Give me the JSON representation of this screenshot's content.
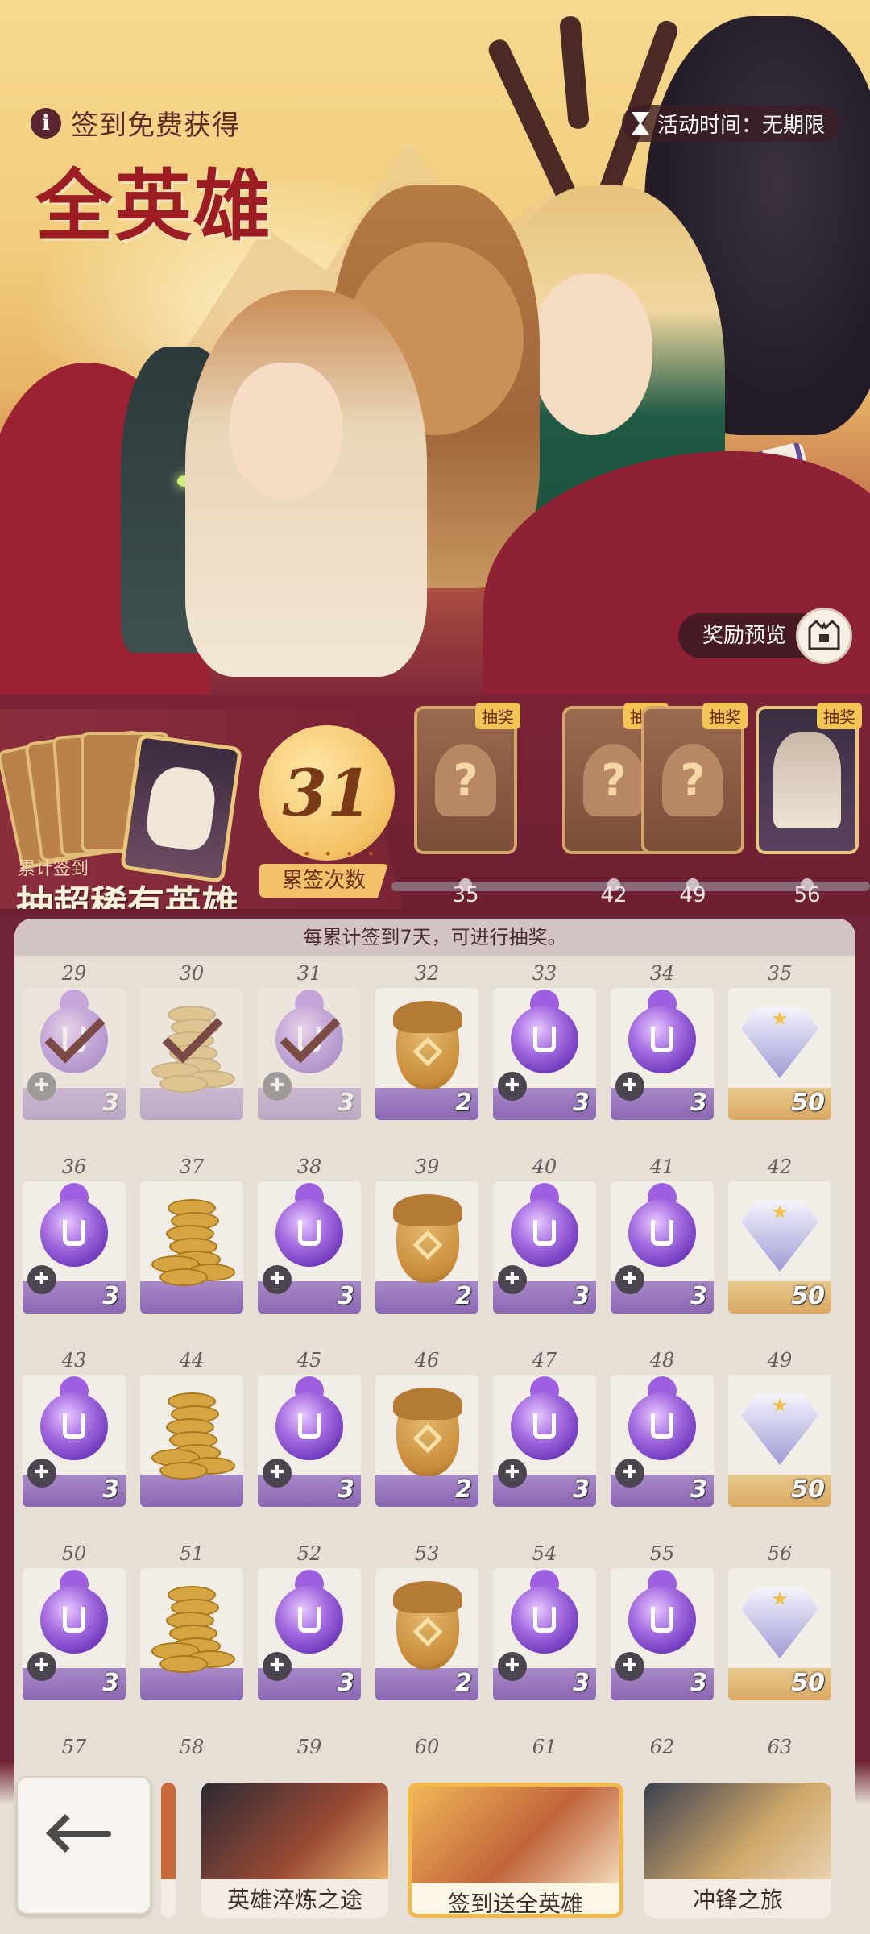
{
  "header": {
    "subtitle": "签到免费获得",
    "title": "全英雄",
    "activity_time": "活动时间：无期限",
    "reward_preview": "奖励预览"
  },
  "draw": {
    "cumulative_small": "累计签到",
    "cumulative_big": "抽超稀有英雄",
    "count": "31",
    "count_dots": "• • • •",
    "count_label": "累签次数",
    "milestones": [
      {
        "day": "35",
        "tag": "抽奖",
        "type": "mystery"
      },
      {
        "day": "42",
        "tag": "抽奖",
        "type": "mystery"
      },
      {
        "day": "49",
        "tag": "抽奖",
        "type": "mystery"
      },
      {
        "day": "56",
        "tag": "抽奖",
        "type": "hero"
      }
    ]
  },
  "grid": {
    "notice": "每累计签到7天，可进行抽奖。",
    "rows": [
      [
        {
          "day": "29",
          "item": "orb",
          "qty": "3",
          "claimed": true
        },
        {
          "day": "30",
          "item": "coins",
          "qty": "",
          "claimed": true
        },
        {
          "day": "31",
          "item": "orb",
          "qty": "3",
          "claimed": true
        },
        {
          "day": "32",
          "item": "acorn",
          "qty": "2",
          "claimed": false
        },
        {
          "day": "33",
          "item": "orb",
          "qty": "3",
          "claimed": false
        },
        {
          "day": "34",
          "item": "orb",
          "qty": "3",
          "claimed": false
        },
        {
          "day": "35",
          "item": "diamond",
          "qty": "50",
          "claimed": false
        }
      ],
      [
        {
          "day": "36",
          "item": "orb",
          "qty": "3",
          "claimed": false
        },
        {
          "day": "37",
          "item": "coins",
          "qty": "",
          "claimed": false
        },
        {
          "day": "38",
          "item": "orb",
          "qty": "3",
          "claimed": false
        },
        {
          "day": "39",
          "item": "acorn",
          "qty": "2",
          "claimed": false
        },
        {
          "day": "40",
          "item": "orb",
          "qty": "3",
          "claimed": false
        },
        {
          "day": "41",
          "item": "orb",
          "qty": "3",
          "claimed": false
        },
        {
          "day": "42",
          "item": "diamond",
          "qty": "50",
          "claimed": false
        }
      ],
      [
        {
          "day": "43",
          "item": "orb",
          "qty": "3",
          "claimed": false
        },
        {
          "day": "44",
          "item": "coins",
          "qty": "",
          "claimed": false
        },
        {
          "day": "45",
          "item": "orb",
          "qty": "3",
          "claimed": false
        },
        {
          "day": "46",
          "item": "acorn",
          "qty": "2",
          "claimed": false
        },
        {
          "day": "47",
          "item": "orb",
          "qty": "3",
          "claimed": false
        },
        {
          "day": "48",
          "item": "orb",
          "qty": "3",
          "claimed": false
        },
        {
          "day": "49",
          "item": "diamond",
          "qty": "50",
          "claimed": false
        }
      ],
      [
        {
          "day": "50",
          "item": "orb",
          "qty": "3",
          "claimed": false
        },
        {
          "day": "51",
          "item": "coins",
          "qty": "",
          "claimed": false
        },
        {
          "day": "52",
          "item": "orb",
          "qty": "3",
          "claimed": false
        },
        {
          "day": "53",
          "item": "acorn",
          "qty": "2",
          "claimed": false
        },
        {
          "day": "54",
          "item": "orb",
          "qty": "3",
          "claimed": false
        },
        {
          "day": "55",
          "item": "orb",
          "qty": "3",
          "claimed": false
        },
        {
          "day": "56",
          "item": "diamond",
          "qty": "50",
          "claimed": false
        }
      ]
    ],
    "next_row_days": [
      "57",
      "58",
      "59",
      "60",
      "61",
      "62",
      "63"
    ]
  },
  "nav": {
    "tabs": [
      {
        "label": "英雄淬炼之途",
        "active": false
      },
      {
        "label": "签到送全英雄",
        "active": true
      },
      {
        "label": "冲锋之旅",
        "active": false
      }
    ]
  }
}
